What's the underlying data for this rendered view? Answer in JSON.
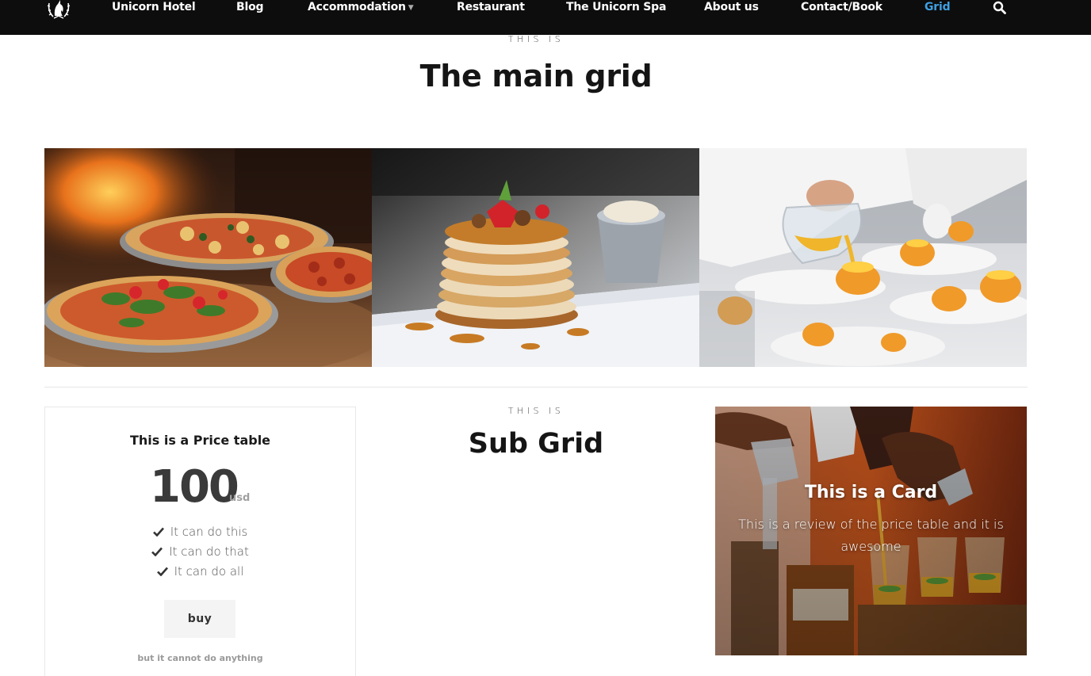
{
  "nav": {
    "items": [
      {
        "label": "Unicorn Hotel"
      },
      {
        "label": "Blog"
      },
      {
        "label": "Accommodation"
      },
      {
        "label": "Restaurant"
      },
      {
        "label": "The Unicorn Spa"
      },
      {
        "label": "About us"
      },
      {
        "label": "Contact/Book"
      },
      {
        "label": "Grid"
      }
    ],
    "active": "Grid",
    "active_color": "#3ea0e3",
    "background": "#0d0d0d",
    "icons": [
      "unicorn-logo-icon",
      "chevron-down-icon",
      "search-icon"
    ]
  },
  "main": {
    "eyebrow": "THIS IS",
    "title": "The main grid",
    "images": [
      {
        "icon": "pizza-photo"
      },
      {
        "icon": "pancakes-photo"
      },
      {
        "icon": "chef-plating-photo"
      }
    ]
  },
  "price_table": {
    "title": "This is a Price table",
    "amount": "100",
    "unit": "usd",
    "features": [
      {
        "label": "It can do this"
      },
      {
        "label": "It can do that"
      },
      {
        "label": "It can do all"
      }
    ],
    "button_label": "buy",
    "note": "but it cannot do anything"
  },
  "sub_grid": {
    "eyebrow": "THIS IS",
    "title": "Sub Grid"
  },
  "card": {
    "title": "This is a Card",
    "text": "This is a review of the price table and it is awesome",
    "icon": "cocktail-bar-photo"
  }
}
